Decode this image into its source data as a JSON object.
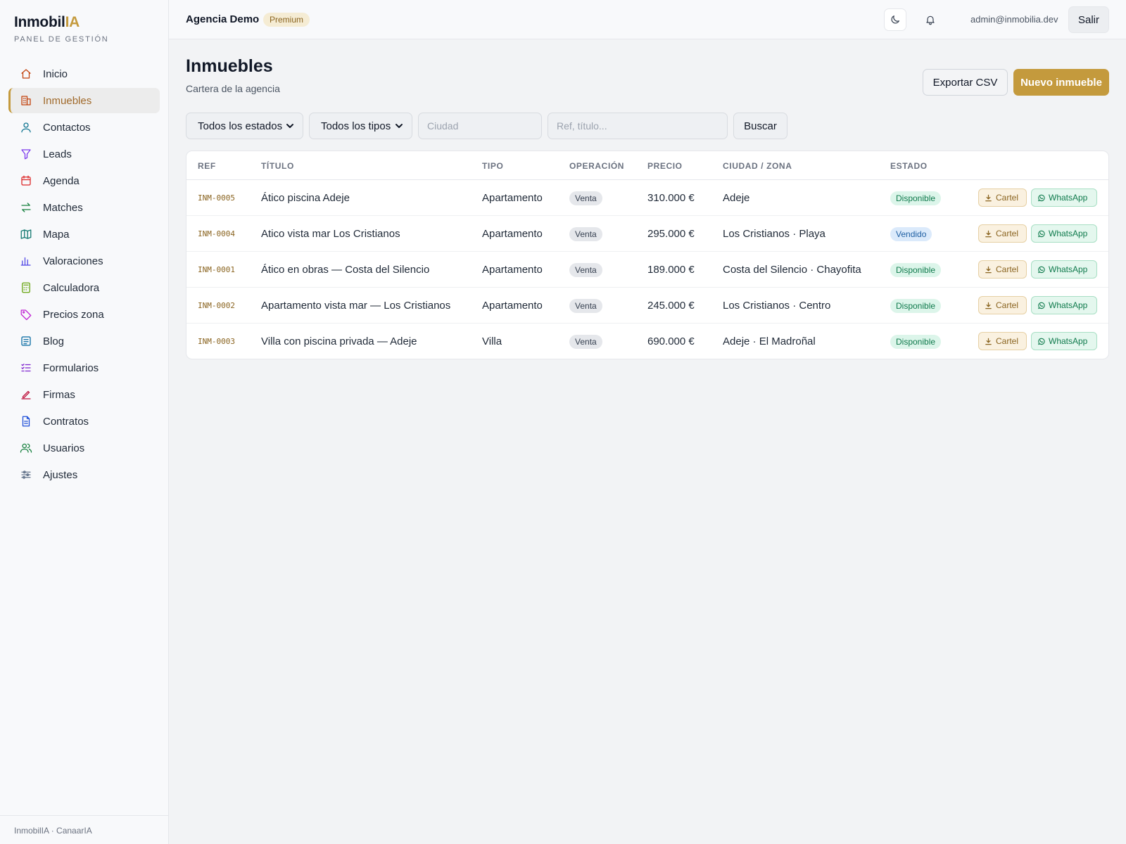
{
  "brand": {
    "name_main": "Inmobil",
    "name_accent": "IA",
    "subtitle": "PANEL DE GESTIÓN"
  },
  "colors": {
    "accent": "#c49a3d",
    "active_text": "#a0692a",
    "success": "#0f7a4c",
    "info": "#1e5fa3"
  },
  "sidebar": {
    "items": [
      {
        "label": "Inicio",
        "icon": "home-icon",
        "active": false
      },
      {
        "label": "Inmuebles",
        "icon": "building-icon",
        "active": true
      },
      {
        "label": "Contactos",
        "icon": "user-icon",
        "active": false
      },
      {
        "label": "Leads",
        "icon": "funnel-icon",
        "active": false
      },
      {
        "label": "Agenda",
        "icon": "calendar-icon",
        "active": false
      },
      {
        "label": "Matches",
        "icon": "arrows-swap-icon",
        "active": false
      },
      {
        "label": "Mapa",
        "icon": "map-icon",
        "active": false
      },
      {
        "label": "Valoraciones",
        "icon": "bar-chart-icon",
        "active": false
      },
      {
        "label": "Calculadora",
        "icon": "calculator-icon",
        "active": false
      },
      {
        "label": "Precios zona",
        "icon": "tag-icon",
        "active": false
      },
      {
        "label": "Blog",
        "icon": "article-icon",
        "active": false
      },
      {
        "label": "Formularios",
        "icon": "checklist-icon",
        "active": false
      },
      {
        "label": "Firmas",
        "icon": "pen-icon",
        "active": false
      },
      {
        "label": "Contratos",
        "icon": "document-icon",
        "active": false
      },
      {
        "label": "Usuarios",
        "icon": "users-icon",
        "active": false
      },
      {
        "label": "Ajustes",
        "icon": "sliders-icon",
        "active": false
      }
    ],
    "footer": "InmobilIA · CanaarIA"
  },
  "topbar": {
    "agency": "Agencia Demo",
    "plan": "Premium",
    "theme_icon": "moon-icon",
    "notifications_icon": "bell-icon",
    "user_email": "admin@inmobilia.dev",
    "logout_label": "Salir"
  },
  "page": {
    "title": "Inmuebles",
    "subtitle": "Cartera de la agencia",
    "export_label": "Exportar CSV",
    "new_label": "Nuevo inmueble"
  },
  "filters": {
    "status_selected": "Todos los estados",
    "type_selected": "Todos los tipos",
    "city_placeholder": "Ciudad",
    "query_placeholder": "Ref, título...",
    "search_label": "Buscar"
  },
  "table": {
    "headers": {
      "ref": "REF",
      "title": "TÍTULO",
      "type": "TIPO",
      "operation": "OPERACIÓN",
      "price": "PRECIO",
      "city": "CIUDAD / ZONA",
      "status": "ESTADO"
    },
    "action_poster": "Cartel",
    "action_whatsapp": "WhatsApp",
    "rows": [
      {
        "ref": "INM-0005",
        "title": "Ático piscina Adeje",
        "type": "Apartamento",
        "operation": "Venta",
        "price": "310.000 €",
        "city": "Adeje",
        "status": "Disponible",
        "status_kind": "ok"
      },
      {
        "ref": "INM-0004",
        "title": "Atico vista mar Los Cristianos",
        "type": "Apartamento",
        "operation": "Venta",
        "price": "295.000 €",
        "city": "Los Cristianos · Playa",
        "status": "Vendido",
        "status_kind": "sold"
      },
      {
        "ref": "INM-0001",
        "title": "Ático en obras — Costa del Silencio",
        "type": "Apartamento",
        "operation": "Venta",
        "price": "189.000 €",
        "city": "Costa del Silencio · Chayofita",
        "status": "Disponible",
        "status_kind": "ok"
      },
      {
        "ref": "INM-0002",
        "title": "Apartamento vista mar — Los Cristianos",
        "type": "Apartamento",
        "operation": "Venta",
        "price": "245.000 €",
        "city": "Los Cristianos · Centro",
        "status": "Disponible",
        "status_kind": "ok"
      },
      {
        "ref": "INM-0003",
        "title": "Villa con piscina privada — Adeje",
        "type": "Villa",
        "operation": "Venta",
        "price": "690.000 €",
        "city": "Adeje · El Madroñal",
        "status": "Disponible",
        "status_kind": "ok"
      }
    ]
  }
}
